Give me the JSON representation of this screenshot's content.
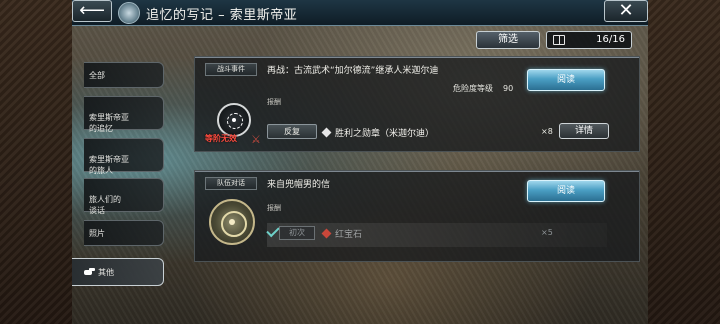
{
  "header": {
    "title": "追忆的写记 – 索里斯帝亚"
  },
  "toolbar": {
    "filter_label": "筛选",
    "counter": "16/16"
  },
  "sidebar": {
    "items": [
      {
        "label": "全部",
        "active": false
      },
      {
        "label": "索里斯帝亚\n的追忆",
        "active": false
      },
      {
        "label": "索里斯帝亚\n的旅人",
        "active": false
      },
      {
        "label": "旅人们的\n谈话",
        "active": false
      },
      {
        "label": "照片",
        "active": false
      },
      {
        "label": "其他",
        "active": true
      }
    ]
  },
  "quests": [
    {
      "tag": "战斗事件",
      "title": "再战：古流武术“加尔德流”继承人米迦尔迪",
      "danger_label": "危险度等级",
      "danger_value": "90",
      "read_label": "阅读",
      "reward_label": "报酬",
      "badge": "等阶无效",
      "status": "反复",
      "reward_item": "胜利之勋章（米迦尔迪）",
      "reward_qty": "×8",
      "detail_label": "详情"
    },
    {
      "tag": "队伍对话",
      "title": "来自兜帽男的信",
      "read_label": "阅读",
      "reward_label": "报酬",
      "status": "初次",
      "reward_item": "红宝石",
      "reward_qty": "×5"
    }
  ],
  "colors": {
    "accent": "#4a9fc4",
    "badge": "#ff4b3e",
    "check": "#6fd1c9"
  }
}
